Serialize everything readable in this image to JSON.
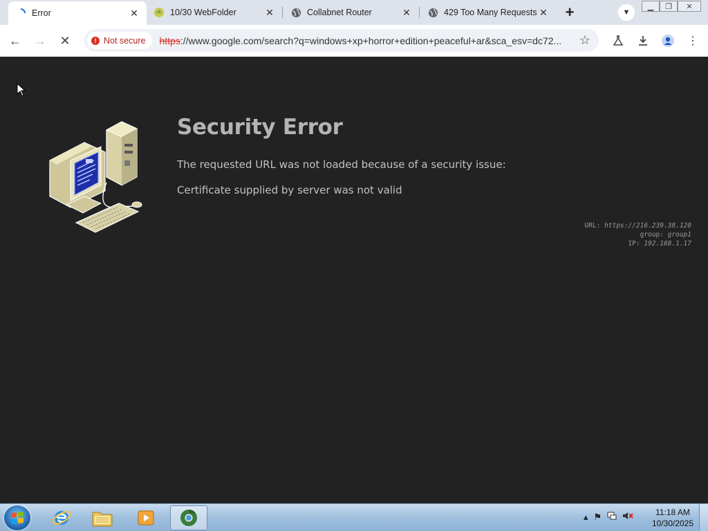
{
  "tabs": [
    {
      "title": "Error",
      "icon": "loading-spinner-icon",
      "active": true
    },
    {
      "title": "10/30 WebFolder",
      "icon": "webfolder-icon",
      "active": false
    },
    {
      "title": "Collabnet Router",
      "icon": "globe-icon",
      "active": false
    },
    {
      "title": "429 Too Many Requests",
      "icon": "globe-icon",
      "active": false
    }
  ],
  "toolbar": {
    "security_chip": "Not secure",
    "url_scheme": "https",
    "url_rest": "://www.google.com/search?q=windows+xp+horror+edition+peaceful+ar&sca_esv=dc72..."
  },
  "page": {
    "title": "Security Error",
    "message": "The requested URL was not loaded because of a security issue:",
    "reason": "Certificate supplied by server was not valid",
    "meta": {
      "url_label": "URL:",
      "url_value": "https://216.239.38.120",
      "group_label": "group:",
      "group_value": "group1",
      "ip_label": "IP:",
      "ip_value": "192.168.1.17"
    }
  },
  "taskbar": {
    "time": "11:18 AM",
    "date": "10/30/2025"
  },
  "colors": {
    "page_bg": "#222222",
    "title_text": "#b4b4b4",
    "not_secure_red": "#d93025",
    "monitor_screen": "#1d2ea8"
  }
}
